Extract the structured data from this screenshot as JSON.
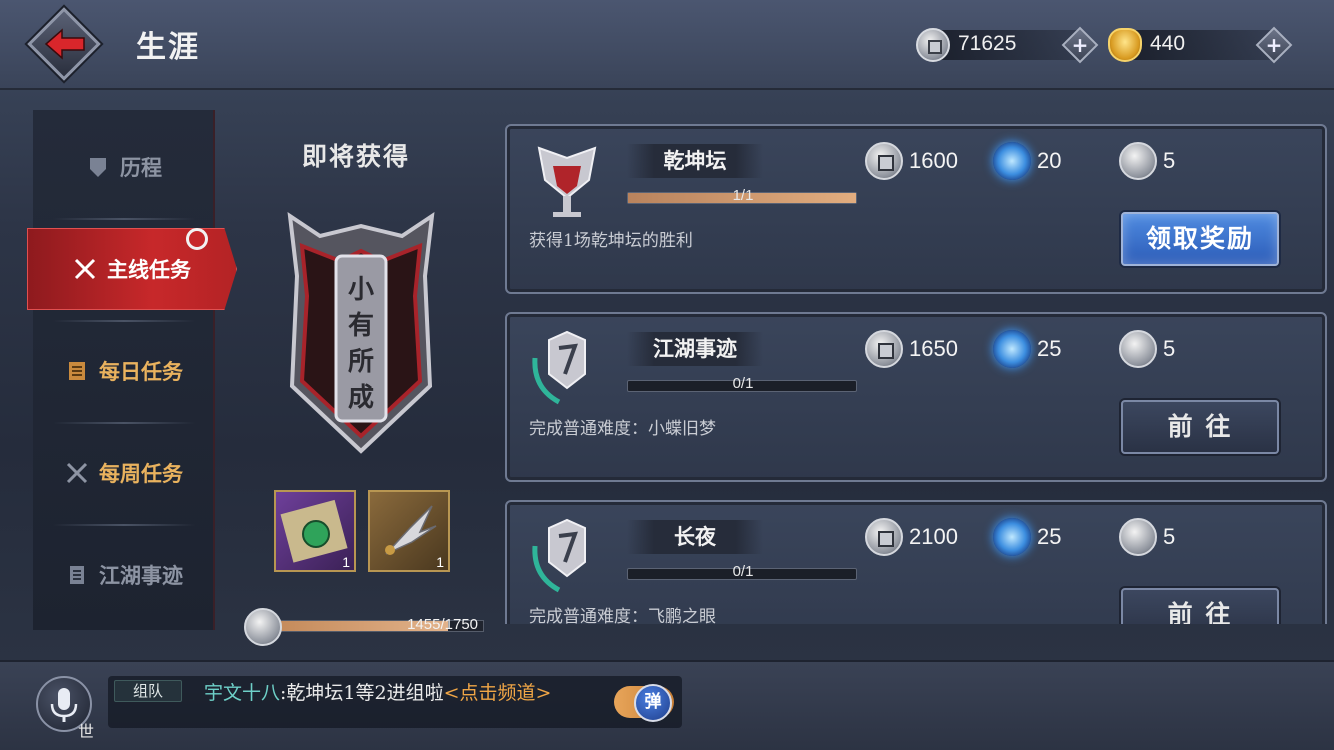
{
  "header": {
    "title": "生涯",
    "currencies": [
      {
        "icon": "silver-coin-icon",
        "value": "71625"
      },
      {
        "icon": "gold-ingot-icon",
        "value": "440"
      }
    ]
  },
  "sidebar": {
    "items": [
      {
        "label": "历程",
        "icon": "shield-icon",
        "state": "muted"
      },
      {
        "label": "主线任务",
        "icon": "crossed-blades-icon",
        "state": "active"
      },
      {
        "label": "每日任务",
        "icon": "scroll-icon",
        "state": "normal"
      },
      {
        "label": "每周任务",
        "icon": "crossed-blades-icon",
        "state": "normal"
      },
      {
        "label": "江湖事迹",
        "icon": "book-icon",
        "state": "muted"
      }
    ]
  },
  "upcoming": {
    "title": "即将获得",
    "emblem_text": "小有所成",
    "items": [
      {
        "icon": "scroll-item-icon",
        "count": "1"
      },
      {
        "icon": "dart-item-icon",
        "count": "1"
      }
    ],
    "progress_text": "1455/1750",
    "progress_fraction": 0.831
  },
  "tasks": [
    {
      "name": "乾坤坛",
      "progress_text": "1/1",
      "progress_fraction": 1.0,
      "description": "获得1场乾坤坛的胜利",
      "rewards": [
        "1600",
        "20",
        "5"
      ],
      "button": "领取奖励",
      "button_type": "claim"
    },
    {
      "name": "江湖事迹",
      "progress_text": "0/1",
      "progress_fraction": 0,
      "description": "完成普通难度：小蝶旧梦",
      "rewards": [
        "1650",
        "25",
        "5"
      ],
      "button": "前 往",
      "button_type": "go"
    },
    {
      "name": "长夜",
      "progress_text": "0/1",
      "progress_fraction": 0,
      "description": "完成普通难度：飞鹏之眼",
      "rewards": [
        "2100",
        "25",
        "5"
      ],
      "button": "前 往",
      "button_type": "go"
    }
  ],
  "chat": {
    "channel_tag": "组队",
    "mic_label": "世",
    "sender": "宇文十八",
    "message": ":乾坤坛1等2进组啦",
    "link": "<点击频道>",
    "popup_label": "弹"
  },
  "colors": {
    "active_tab": "#c7282a",
    "gold_text": "#e9b25e",
    "claim_button": "#3f78d8",
    "chat_sender": "#6ed0c8",
    "chat_link": "#f0a646"
  }
}
